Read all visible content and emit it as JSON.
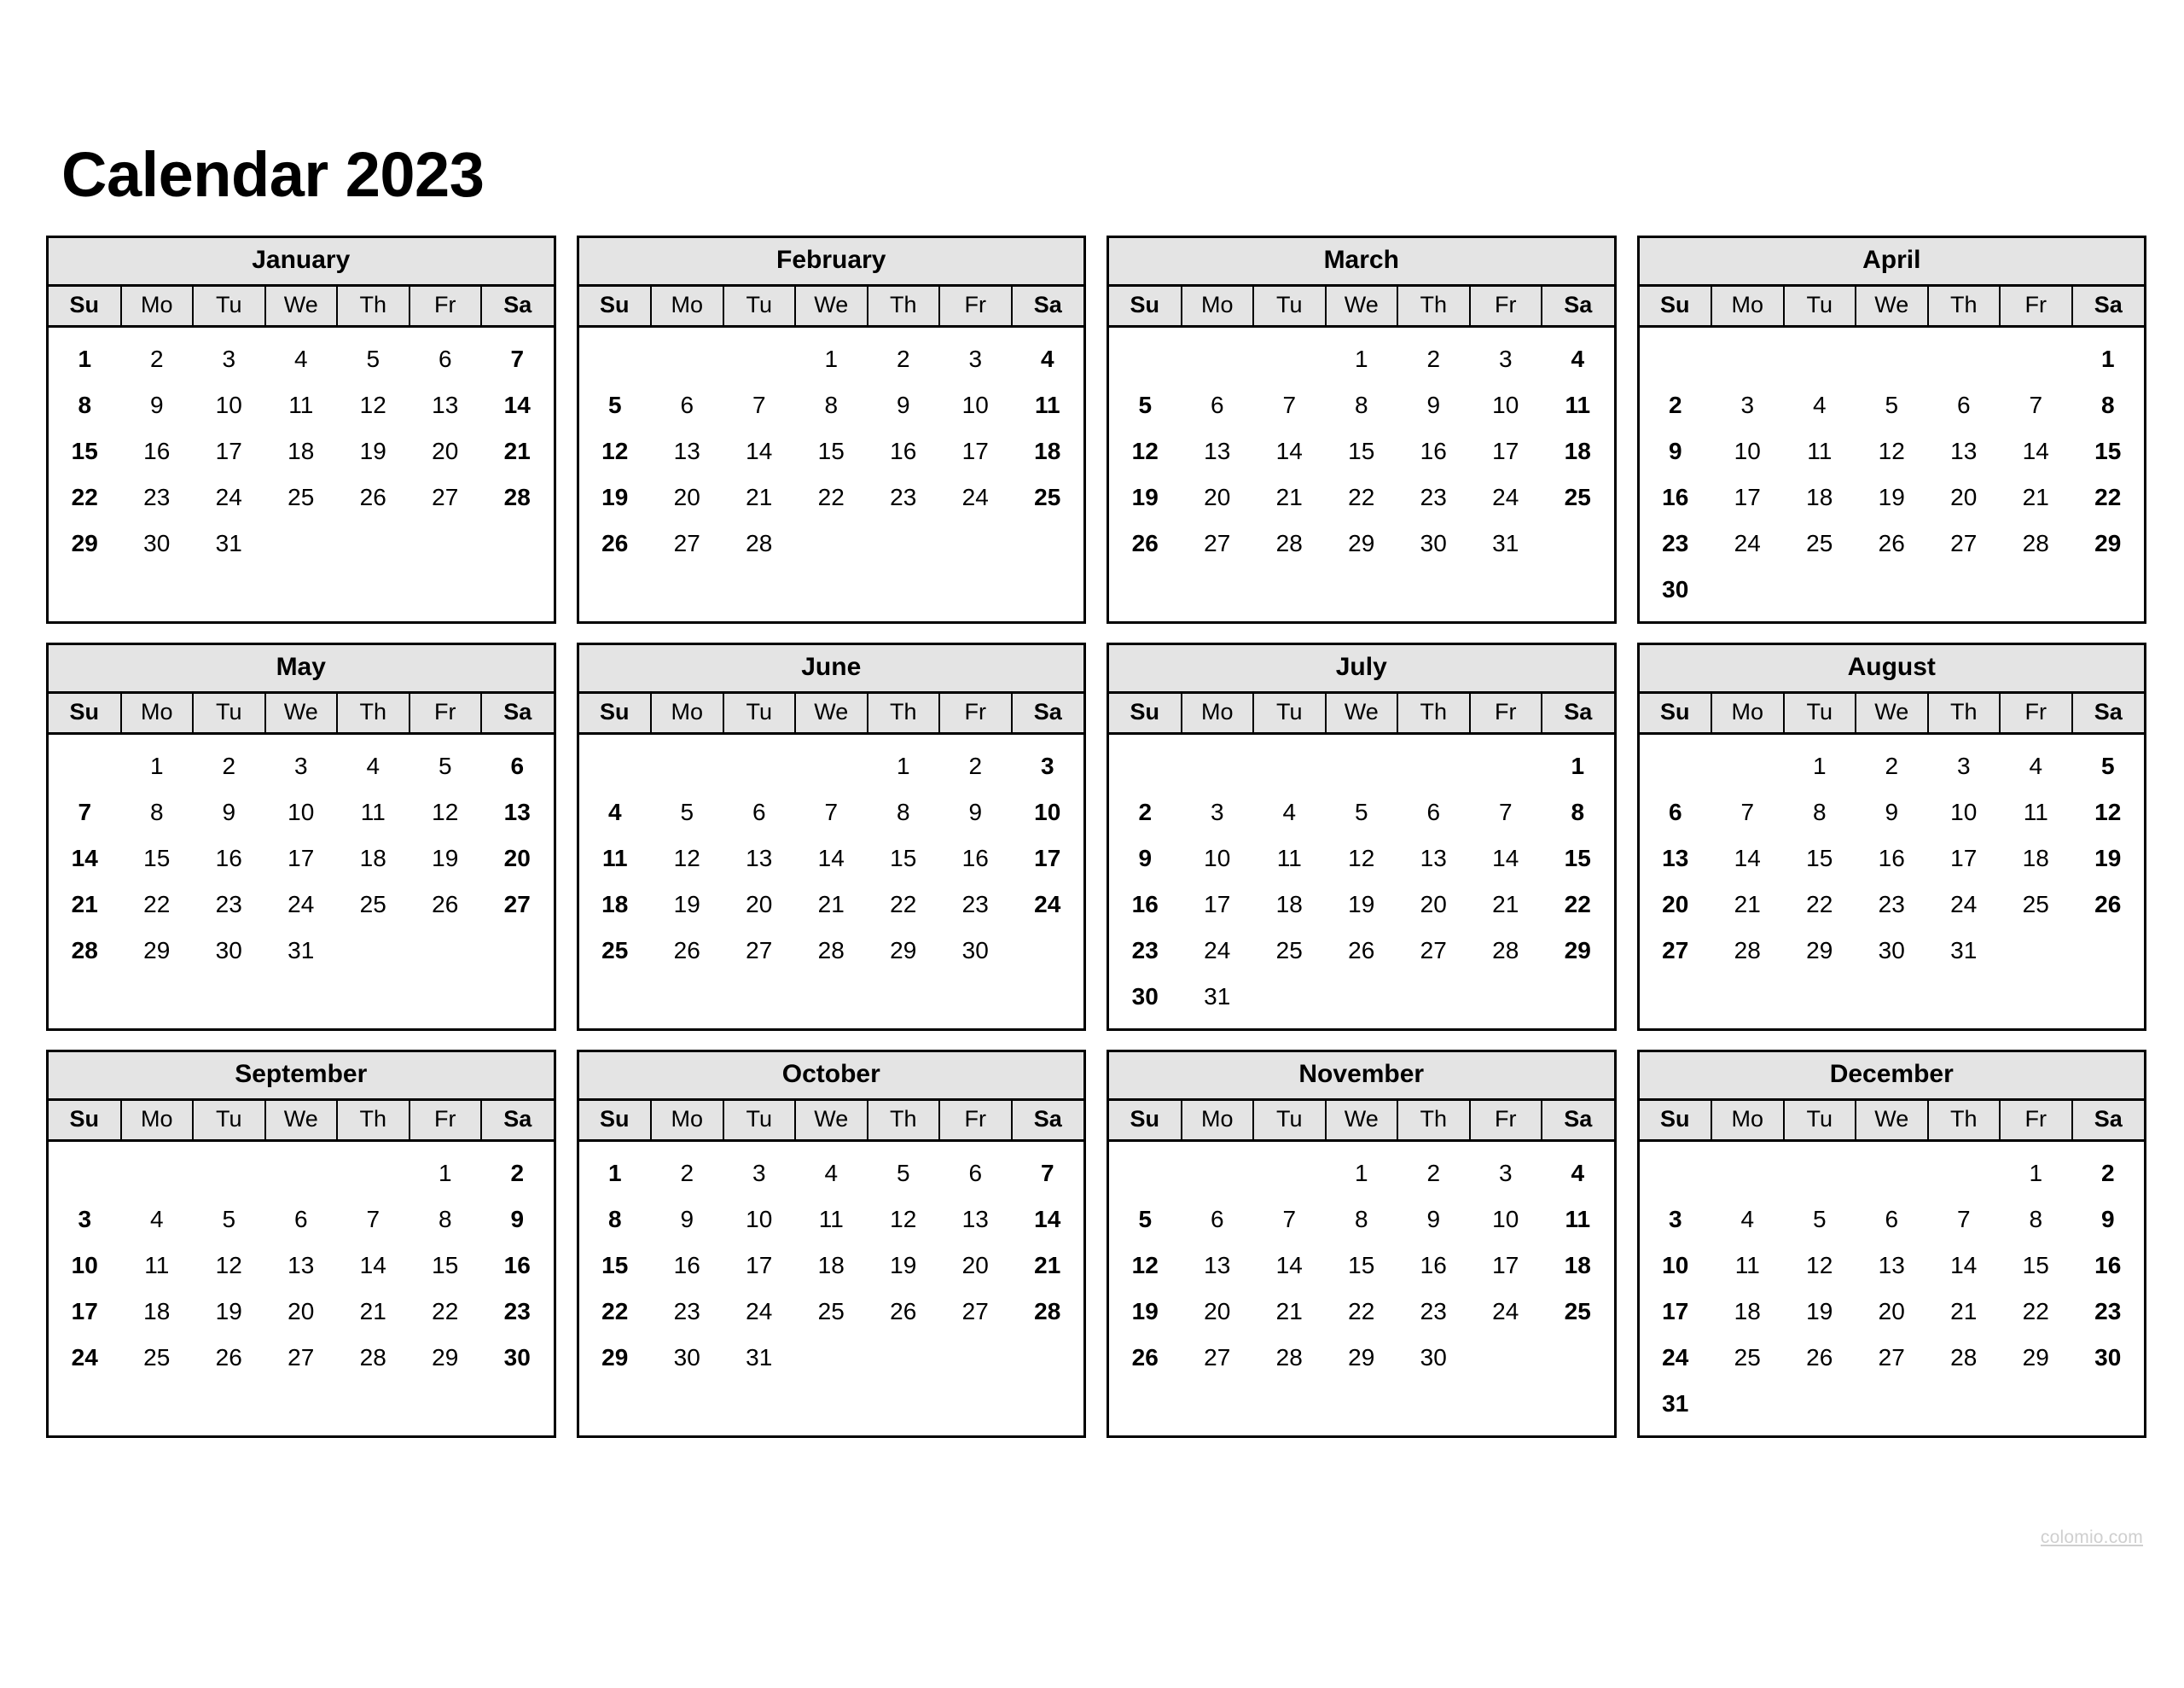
{
  "title": "Calendar 2023",
  "year": 2023,
  "weekday_headers": [
    "Su",
    "Mo",
    "Tu",
    "We",
    "Th",
    "Fr",
    "Sa"
  ],
  "weekend_columns": [
    0,
    6
  ],
  "colors": {
    "header_background": "#e4e4e4",
    "border": "#000000",
    "text": "#000000",
    "watermark": "#cfcfcf",
    "page_background": "#ffffff"
  },
  "watermark": "colomio.com",
  "months": [
    {
      "name": "January",
      "weeks": [
        [
          "1",
          "2",
          "3",
          "4",
          "5",
          "6",
          "7"
        ],
        [
          "8",
          "9",
          "10",
          "11",
          "12",
          "13",
          "14"
        ],
        [
          "15",
          "16",
          "17",
          "18",
          "19",
          "20",
          "21"
        ],
        [
          "22",
          "23",
          "24",
          "25",
          "26",
          "27",
          "28"
        ],
        [
          "29",
          "30",
          "31",
          "",
          "",
          "",
          ""
        ]
      ]
    },
    {
      "name": "February",
      "weeks": [
        [
          "",
          "",
          "",
          "1",
          "2",
          "3",
          "4"
        ],
        [
          "5",
          "6",
          "7",
          "8",
          "9",
          "10",
          "11"
        ],
        [
          "12",
          "13",
          "14",
          "15",
          "16",
          "17",
          "18"
        ],
        [
          "19",
          "20",
          "21",
          "22",
          "23",
          "24",
          "25"
        ],
        [
          "26",
          "27",
          "28",
          "",
          "",
          "",
          ""
        ]
      ]
    },
    {
      "name": "March",
      "weeks": [
        [
          "",
          "",
          "",
          "1",
          "2",
          "3",
          "4"
        ],
        [
          "5",
          "6",
          "7",
          "8",
          "9",
          "10",
          "11"
        ],
        [
          "12",
          "13",
          "14",
          "15",
          "16",
          "17",
          "18"
        ],
        [
          "19",
          "20",
          "21",
          "22",
          "23",
          "24",
          "25"
        ],
        [
          "26",
          "27",
          "28",
          "29",
          "30",
          "31",
          ""
        ]
      ]
    },
    {
      "name": "April",
      "weeks": [
        [
          "",
          "",
          "",
          "",
          "",
          "",
          "1"
        ],
        [
          "2",
          "3",
          "4",
          "5",
          "6",
          "7",
          "8"
        ],
        [
          "9",
          "10",
          "11",
          "12",
          "13",
          "14",
          "15"
        ],
        [
          "16",
          "17",
          "18",
          "19",
          "20",
          "21",
          "22"
        ],
        [
          "23",
          "24",
          "25",
          "26",
          "27",
          "28",
          "29"
        ],
        [
          "30",
          "",
          "",
          "",
          "",
          "",
          ""
        ]
      ]
    },
    {
      "name": "May",
      "weeks": [
        [
          "",
          "1",
          "2",
          "3",
          "4",
          "5",
          "6"
        ],
        [
          "7",
          "8",
          "9",
          "10",
          "11",
          "12",
          "13"
        ],
        [
          "14",
          "15",
          "16",
          "17",
          "18",
          "19",
          "20"
        ],
        [
          "21",
          "22",
          "23",
          "24",
          "25",
          "26",
          "27"
        ],
        [
          "28",
          "29",
          "30",
          "31",
          "",
          "",
          ""
        ]
      ]
    },
    {
      "name": "June",
      "weeks": [
        [
          "",
          "",
          "",
          "",
          "1",
          "2",
          "3"
        ],
        [
          "4",
          "5",
          "6",
          "7",
          "8",
          "9",
          "10"
        ],
        [
          "11",
          "12",
          "13",
          "14",
          "15",
          "16",
          "17"
        ],
        [
          "18",
          "19",
          "20",
          "21",
          "22",
          "23",
          "24"
        ],
        [
          "25",
          "26",
          "27",
          "28",
          "29",
          "30",
          ""
        ]
      ]
    },
    {
      "name": "July",
      "weeks": [
        [
          "",
          "",
          "",
          "",
          "",
          "",
          "1"
        ],
        [
          "2",
          "3",
          "4",
          "5",
          "6",
          "7",
          "8"
        ],
        [
          "9",
          "10",
          "11",
          "12",
          "13",
          "14",
          "15"
        ],
        [
          "16",
          "17",
          "18",
          "19",
          "20",
          "21",
          "22"
        ],
        [
          "23",
          "24",
          "25",
          "26",
          "27",
          "28",
          "29"
        ],
        [
          "30",
          "31",
          "",
          "",
          "",
          "",
          ""
        ]
      ]
    },
    {
      "name": "August",
      "weeks": [
        [
          "",
          "",
          "1",
          "2",
          "3",
          "4",
          "5"
        ],
        [
          "6",
          "7",
          "8",
          "9",
          "10",
          "11",
          "12"
        ],
        [
          "13",
          "14",
          "15",
          "16",
          "17",
          "18",
          "19"
        ],
        [
          "20",
          "21",
          "22",
          "23",
          "24",
          "25",
          "26"
        ],
        [
          "27",
          "28",
          "29",
          "30",
          "31",
          "",
          ""
        ]
      ]
    },
    {
      "name": "September",
      "weeks": [
        [
          "",
          "",
          "",
          "",
          "",
          "1",
          "2"
        ],
        [
          "3",
          "4",
          "5",
          "6",
          "7",
          "8",
          "9"
        ],
        [
          "10",
          "11",
          "12",
          "13",
          "14",
          "15",
          "16"
        ],
        [
          "17",
          "18",
          "19",
          "20",
          "21",
          "22",
          "23"
        ],
        [
          "24",
          "25",
          "26",
          "27",
          "28",
          "29",
          "30"
        ]
      ]
    },
    {
      "name": "October",
      "weeks": [
        [
          "1",
          "2",
          "3",
          "4",
          "5",
          "6",
          "7"
        ],
        [
          "8",
          "9",
          "10",
          "11",
          "12",
          "13",
          "14"
        ],
        [
          "15",
          "16",
          "17",
          "18",
          "19",
          "20",
          "21"
        ],
        [
          "22",
          "23",
          "24",
          "25",
          "26",
          "27",
          "28"
        ],
        [
          "29",
          "30",
          "31",
          "",
          "",
          "",
          ""
        ]
      ]
    },
    {
      "name": "November",
      "weeks": [
        [
          "",
          "",
          "",
          "1",
          "2",
          "3",
          "4"
        ],
        [
          "5",
          "6",
          "7",
          "8",
          "9",
          "10",
          "11"
        ],
        [
          "12",
          "13",
          "14",
          "15",
          "16",
          "17",
          "18"
        ],
        [
          "19",
          "20",
          "21",
          "22",
          "23",
          "24",
          "25"
        ],
        [
          "26",
          "27",
          "28",
          "29",
          "30",
          "",
          ""
        ]
      ]
    },
    {
      "name": "December",
      "weeks": [
        [
          "",
          "",
          "",
          "",
          "",
          "1",
          "2"
        ],
        [
          "3",
          "4",
          "5",
          "6",
          "7",
          "8",
          "9"
        ],
        [
          "10",
          "11",
          "12",
          "13",
          "14",
          "15",
          "16"
        ],
        [
          "17",
          "18",
          "19",
          "20",
          "21",
          "22",
          "23"
        ],
        [
          "24",
          "25",
          "26",
          "27",
          "28",
          "29",
          "30"
        ],
        [
          "31",
          "",
          "",
          "",
          "",
          "",
          ""
        ]
      ]
    }
  ]
}
